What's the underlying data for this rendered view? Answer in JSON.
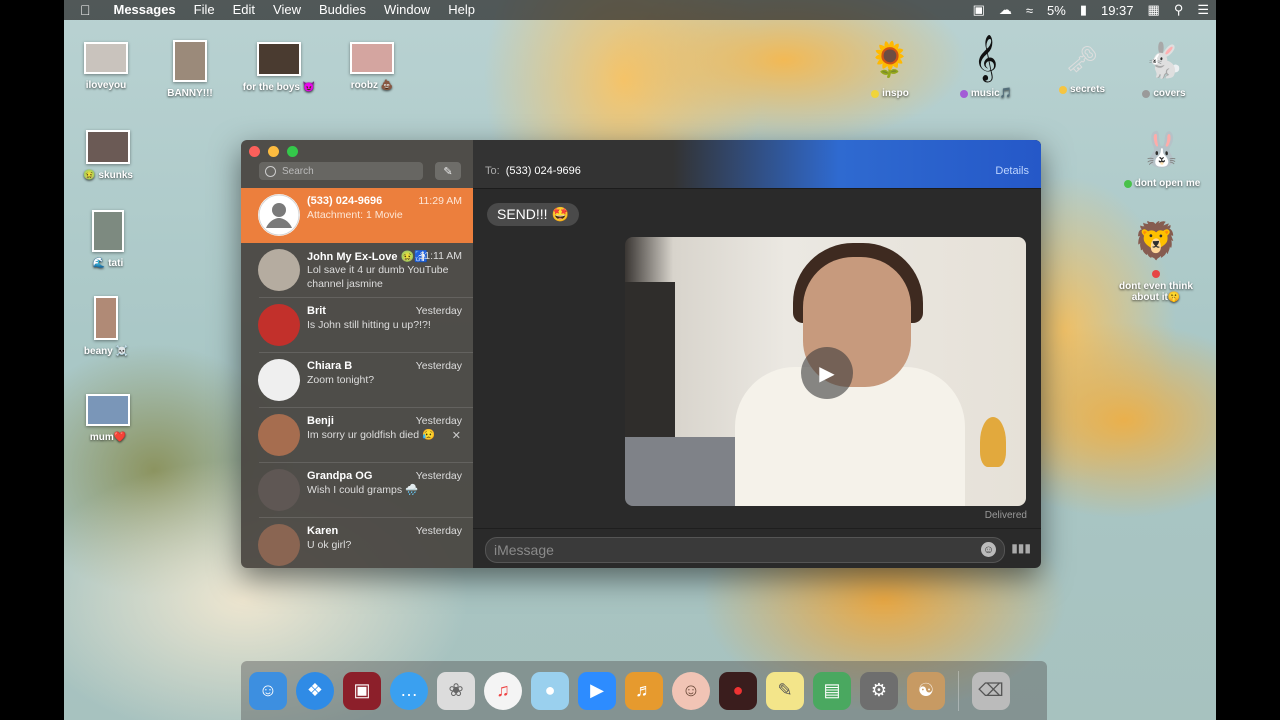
{
  "menubar": {
    "apple": "",
    "app_name": "Messages",
    "menus": [
      "File",
      "Edit",
      "View",
      "Buddies",
      "Window",
      "Help"
    ],
    "battery": "5%",
    "clock": "19:37"
  },
  "desktop_icons": [
    {
      "label": "iloveyou",
      "color": "#c9c3bd"
    },
    {
      "label": "BANNY!!!",
      "color": "#9b8a7a"
    },
    {
      "label": "for the boys 😈",
      "color": "#4a3b30"
    },
    {
      "label": "roobz 💩",
      "color": "#d4a5a0"
    },
    {
      "label": "skunks",
      "dot": "🤢",
      "color": "#6b5a55"
    },
    {
      "label": "tati",
      "dot": "🌊",
      "color": "#7d8a80"
    },
    {
      "label": "beany ☠️",
      "color": "#b08a76"
    },
    {
      "label": "mum❤️",
      "color": "#7a96b8"
    }
  ],
  "right_icons": [
    {
      "label": "inspo",
      "dot_color": "#f0d43a",
      "glyph": "🌻"
    },
    {
      "label": "music🎵",
      "dot_color": "#a35cd6",
      "glyph": "𝄞"
    },
    {
      "label": "secrets",
      "dot_color": "#f5c542",
      "glyph": "🗝"
    },
    {
      "label": "covers",
      "dot_color": "#9a9a9a",
      "glyph": "🐇"
    },
    {
      "label": "dont open me",
      "dot_color": "#49c24a",
      "glyph": "🐰"
    },
    {
      "label": "dont even think about it🤫",
      "dot_color": "#e64545",
      "glyph": "🦁"
    }
  ],
  "sidebar": {
    "search_placeholder": "Search",
    "compose_glyph": "✎",
    "conversations": [
      {
        "name": "(533) 024-9696",
        "time": "11:29 AM",
        "preview": "Attachment: 1 Movie",
        "active": true,
        "avatar_color": "#ffffff"
      },
      {
        "name": "John My Ex-Love 🤢🚮",
        "time": "11:11 AM",
        "preview": "Lol save it 4 ur dumb YouTube channel jasmine",
        "avatar_color": "#b5aca0"
      },
      {
        "name": "Brit",
        "time": "Yesterday",
        "preview": "Is John still hitting u up?!?!",
        "avatar_color": "#c2302b"
      },
      {
        "name": "Chiara B",
        "time": "Yesterday",
        "preview": "Zoom tonight?",
        "avatar_color": "#efefef"
      },
      {
        "name": "Benji",
        "time": "Yesterday",
        "preview": "Im sorry ur goldfish died 😥",
        "avatar_color": "#a66d4f"
      },
      {
        "name": "Grandpa OG",
        "time": "Yesterday",
        "preview": "Wish I could gramps 🌧️",
        "avatar_color": "#5f5754"
      },
      {
        "name": "Karen",
        "time": "Yesterday",
        "preview": "U ok girl?",
        "avatar_color": "#8a6552"
      }
    ]
  },
  "chat": {
    "to_label": "To:",
    "recipient": "(533) 024-9696",
    "details": "Details",
    "bubble": "SEND!!! 🤩",
    "status": "Delivered",
    "input_placeholder": "iMessage"
  },
  "dock_apps": [
    {
      "name": "finder",
      "color": "#3d8fe0"
    },
    {
      "name": "safari",
      "color": "#2f8be6"
    },
    {
      "name": "photo-booth",
      "color": "#8c1f2a"
    },
    {
      "name": "messages",
      "color": "#3aa0f0"
    },
    {
      "name": "inkscape-rabbit",
      "color": "#dcdcdc"
    },
    {
      "name": "itunes",
      "color": "#f4f4f4"
    },
    {
      "name": "seal",
      "color": "#9ad0ee"
    },
    {
      "name": "zoom",
      "color": "#2d8cff"
    },
    {
      "name": "garageband",
      "color": "#e69a2e"
    },
    {
      "name": "face",
      "color": "#f1c4b5"
    },
    {
      "name": "photo-booth-2",
      "color": "#3a1d1d"
    },
    {
      "name": "stickies",
      "color": "#f3e58a"
    },
    {
      "name": "preview",
      "color": "#4aa860"
    },
    {
      "name": "system-preferences",
      "color": "#6e6e6e"
    },
    {
      "name": "contacts",
      "color": "#c79a63"
    },
    {
      "name": "trash",
      "color": "#bbbbbb"
    }
  ]
}
